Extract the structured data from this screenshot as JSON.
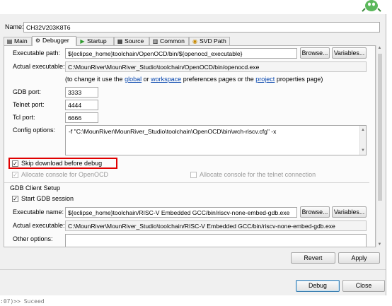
{
  "name_label": "Name:",
  "config_name": "CH32V203K8T6",
  "tabs": [
    {
      "label": "Main",
      "icon": "main-tab-icon",
      "glyph": "▤"
    },
    {
      "label": "Debugger",
      "icon": "debugger-tab-icon",
      "glyph": "⚙"
    },
    {
      "label": "Startup",
      "icon": "startup-tab-icon",
      "glyph": "▶"
    },
    {
      "label": "Source",
      "icon": "source-tab-icon",
      "glyph": "▦"
    },
    {
      "label": "Common",
      "icon": "common-tab-icon",
      "glyph": "▥"
    },
    {
      "label": "SVD Path",
      "icon": "svd-tab-icon",
      "glyph": "◉"
    }
  ],
  "openocd": {
    "executable_path_label": "Executable path:",
    "executable_path": "${eclipse_home}toolchain/OpenOCD/bin/${openocd_executable}",
    "browse": "Browse...",
    "variables": "Variables...",
    "actual_executable_label": "Actual executable:",
    "actual_executable": "C:\\MounRiver\\MounRiver_Studio\\toolchain/OpenOCD/bin/openocd.exe",
    "hint_prefix": "(to change it use the",
    "hint_global": "global",
    "hint_or": "or",
    "hint_workspace": "workspace",
    "hint_middle": "preferences pages or the",
    "hint_project": "project",
    "hint_suffix": "properties page)",
    "gdb_port_label": "GDB port:",
    "gdb_port": "3333",
    "telnet_port_label": "Telnet port:",
    "telnet_port": "4444",
    "tcl_port_label": "Tcl port:",
    "tcl_port": "6666",
    "config_options_label": "Config options:",
    "config_options": "-f \"C:\\MounRiver\\MounRiver_Studio\\toolchain\\OpenOCD\\bin\\wch-riscv.cfg\" -x",
    "skip_download_label": "Skip download before debug",
    "skip_download_checked": true,
    "allocate_console_label": "Allocate console for OpenOCD",
    "allocate_console_checked": true,
    "allocate_telnet_label": "Allocate console for the telnet connection",
    "allocate_telnet_checked": false
  },
  "gdb_client": {
    "section_label": "GDB Client Setup",
    "start_gdb_label": "Start GDB session",
    "start_gdb_checked": true,
    "executable_name_label": "Executable name:",
    "executable_name": "${eclipse_home}toolchain/RISC-V Embedded GCC/bin/riscv-none-embed-gdb.exe",
    "browse": "Browse...",
    "variables": "Variables...",
    "actual_executable_label": "Actual executable:",
    "actual_executable": "C:\\MounRiver\\MounRiver_Studio\\toolchain/RISC-V Embedded GCC/bin/riscv-none-embed-gdb.exe",
    "other_options_label": "Other options:"
  },
  "buttons": {
    "revert": "Revert",
    "apply": "Apply",
    "debug": "Debug",
    "close": "Close"
  },
  "console_text": ":07)>> Suceed",
  "highlight_color": "#e00000"
}
